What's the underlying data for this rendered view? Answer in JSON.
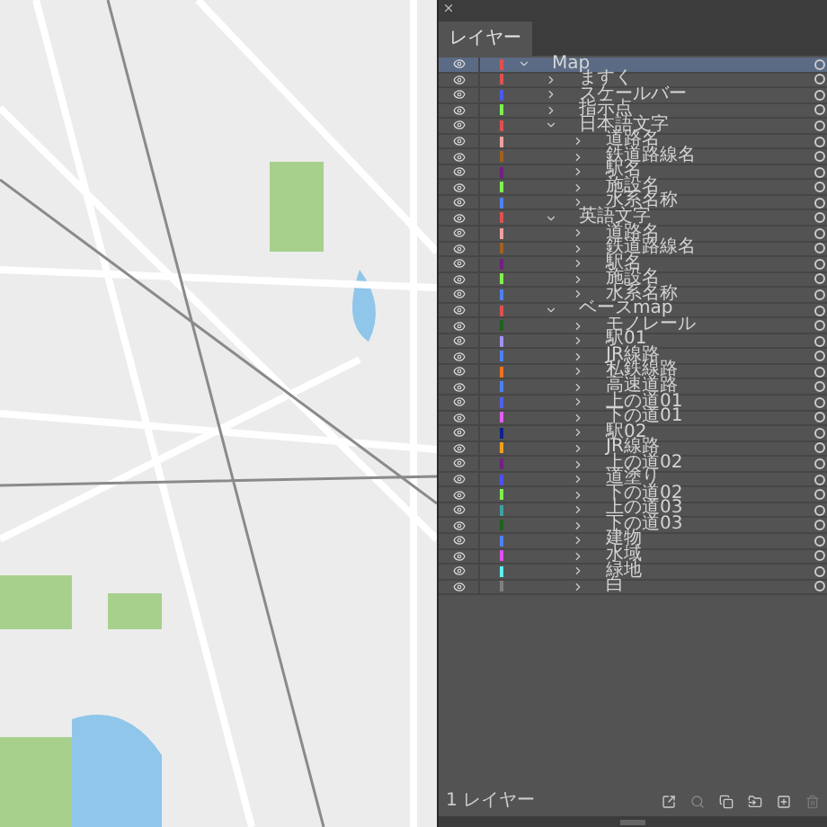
{
  "panel": {
    "tabs": [
      {
        "label": "レイヤー",
        "selected": true
      }
    ],
    "layers": [
      {
        "name": "Map",
        "color": "#e05050",
        "expanded": true,
        "selected": true,
        "children": [
          {
            "name": "ますく",
            "color": "#e05050",
            "expanded": false,
            "selected": false
          },
          {
            "name": "スケールバー",
            "color": "#4a5cf0",
            "expanded": false,
            "selected": false
          },
          {
            "name": "指示点",
            "color": "#80f050",
            "expanded": false,
            "selected": false
          },
          {
            "name": "日本語文字",
            "color": "#e05050",
            "expanded": true,
            "selected": false,
            "children": [
              {
                "name": "道路名",
                "color": "#f0a0a0",
                "expanded": false,
                "selected": false
              },
              {
                "name": "鉄道路線名",
                "color": "#a06020",
                "expanded": false,
                "selected": false
              },
              {
                "name": "駅名",
                "color": "#702080",
                "expanded": false,
                "selected": false
              },
              {
                "name": "施設名",
                "color": "#80f050",
                "expanded": false,
                "selected": false
              },
              {
                "name": "水系名称",
                "color": "#5080f0",
                "expanded": false,
                "selected": false
              }
            ]
          },
          {
            "name": "英語文字",
            "color": "#e05050",
            "expanded": true,
            "selected": false,
            "children": [
              {
                "name": "道路名",
                "color": "#f0a0a0",
                "expanded": false,
                "selected": false
              },
              {
                "name": "鉄道路線名",
                "color": "#a06020",
                "expanded": false,
                "selected": false
              },
              {
                "name": "駅名",
                "color": "#702080",
                "expanded": false,
                "selected": false
              },
              {
                "name": "施設名",
                "color": "#80f050",
                "expanded": false,
                "selected": false
              },
              {
                "name": "水系名称",
                "color": "#5080f0",
                "expanded": false,
                "selected": false
              }
            ]
          },
          {
            "name": "ベースmap",
            "color": "#e05050",
            "expanded": true,
            "selected": false,
            "children": [
              {
                "name": "モノレール",
                "color": "#206020",
                "expanded": false,
                "selected": false
              },
              {
                "name": "駅01",
                "color": "#a090f0",
                "expanded": false,
                "selected": false
              },
              {
                "name": "JR線路",
                "color": "#5080f0",
                "expanded": false,
                "selected": false
              },
              {
                "name": "私鉄線路",
                "color": "#f07020",
                "expanded": false,
                "selected": false
              },
              {
                "name": "高速道路",
                "color": "#5080f0",
                "expanded": false,
                "selected": false
              },
              {
                "name": "上の道01",
                "color": "#5060f0",
                "expanded": false,
                "selected": false
              },
              {
                "name": "下の道01",
                "color": "#e060f0",
                "expanded": false,
                "selected": false
              },
              {
                "name": "駅02",
                "color": "#102090",
                "expanded": false,
                "selected": false
              },
              {
                "name": "JR線路",
                "color": "#f0a020",
                "expanded": false,
                "selected": false
              },
              {
                "name": "上の道02",
                "color": "#702080",
                "expanded": false,
                "selected": false
              },
              {
                "name": "道塗り",
                "color": "#5050f0",
                "expanded": false,
                "selected": false
              },
              {
                "name": "下の道02",
                "color": "#80f050",
                "expanded": false,
                "selected": false
              },
              {
                "name": "上の道03",
                "color": "#40a0a0",
                "expanded": false,
                "selected": false
              },
              {
                "name": "下の道03",
                "color": "#206020",
                "expanded": false,
                "selected": false
              },
              {
                "name": "建物",
                "color": "#5080f0",
                "expanded": false,
                "selected": false
              },
              {
                "name": "水域",
                "color": "#e050f0",
                "expanded": false,
                "selected": false
              },
              {
                "name": "緑地",
                "color": "#60f0f0",
                "expanded": false,
                "selected": false
              },
              {
                "name": "白",
                "color": "#808080",
                "expanded": false,
                "selected": false
              }
            ]
          }
        ]
      }
    ],
    "layer_count": "1 レイヤー"
  }
}
